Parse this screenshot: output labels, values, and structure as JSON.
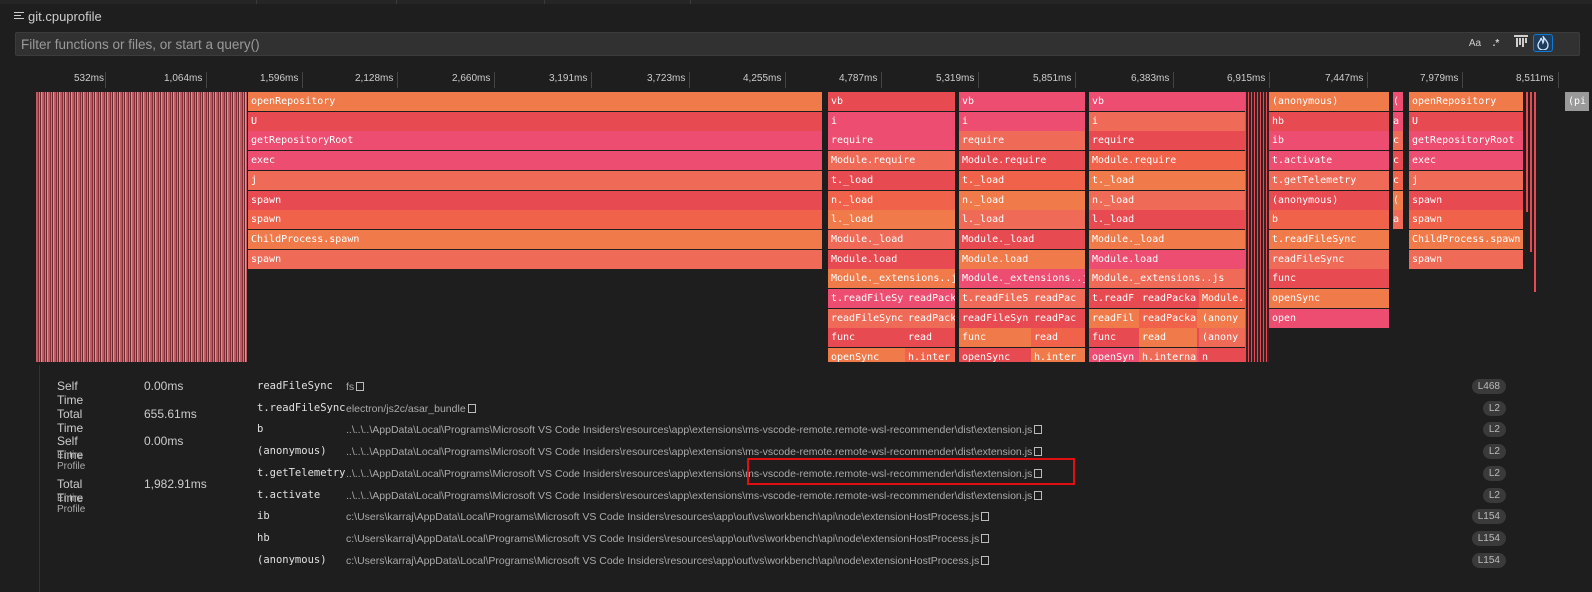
{
  "tab": {
    "title": "git.cpuprofile"
  },
  "filter": {
    "placeholder": "Filter functions or files, or start a query()",
    "case_label": "Aa",
    "regex_label": ".*",
    "buttons": [
      "match-case",
      "regex",
      "bottom-up",
      "flame"
    ]
  },
  "axis": {
    "ticks": [
      "532ms",
      "1,064ms",
      "1,596ms",
      "2,128ms",
      "2,660ms",
      "3,191ms",
      "3,723ms",
      "4,255ms",
      "4,787ms",
      "5,319ms",
      "5,851ms",
      "6,383ms",
      "6,915ms",
      "7,447ms",
      "7,979ms",
      "8,511ms"
    ]
  },
  "colors": {
    "orange": "#f07a4a",
    "red": "#e84a52",
    "pink": "#ec4d70",
    "salmon": "#ef6b58",
    "coral": "#f0624a",
    "grey": "#9a9a9a",
    "selected": "#0e70c0",
    "highlight": "#e01010"
  },
  "flame": {
    "col1": [
      "openRepository",
      "U",
      "getRepositoryRoot",
      "exec",
      "j",
      "spawn",
      "spawn",
      "ChildProcess.spawn",
      "spawn"
    ],
    "col2": [
      "vb",
      "i",
      "require",
      "Module.require",
      "t._load",
      "n._load",
      "l._load",
      "Module._load",
      "Module.load",
      "Module._extensions..js",
      "t.readFileSy",
      "readFileSync",
      "func",
      "openSync"
    ],
    "col2b": [
      "readPack",
      "readPack",
      "read",
      "h.inter"
    ],
    "col3": [
      "vb",
      "i",
      "require",
      "Module.require",
      "t._load",
      "n._load",
      "l._load",
      "Module._load",
      "Module.load",
      "Module._extensions..js",
      "t.readFileS",
      "readFileSyn",
      "func",
      "openSync"
    ],
    "col3b": [
      "readPac",
      "readPac",
      "read",
      "h.inter"
    ],
    "col4": [
      "vb",
      "i",
      "require",
      "Module.require",
      "t._load",
      "n._load",
      "l._load",
      "Module._load",
      "Module.load",
      "Module._extensions..js",
      "t.readF",
      "readFil",
      "func",
      "openSyn"
    ],
    "col4b": [
      "readPacka",
      "readPacka",
      "read",
      "h.interna"
    ],
    "col4c": [
      "Module.",
      "(anony",
      "(anony",
      "n"
    ],
    "col5": [
      "(anonymous)",
      "hb",
      "ib",
      "t.activate",
      "t.getTelemetry",
      "(anonymous)",
      "b",
      "t.readFileSync",
      "readFileSync",
      "func",
      "openSync",
      "open"
    ],
    "col6": [
      "openRepository",
      "U",
      "getRepositoryRoot",
      "exec",
      "j",
      "spawn",
      "spawn",
      "ChildProcess.spawn",
      "spawn"
    ],
    "col5_mini": [
      "(",
      "a",
      "c",
      "c",
      "c",
      "(",
      "a"
    ],
    "far_right": "(pi"
  },
  "stats": {
    "self_time_label": "Self Time",
    "self_time": "0.00ms",
    "total_time_label": "Total Time",
    "total_time": "655.61ms",
    "self_time_profile_label": "Self Time",
    "self_time_profile_sub": "Entire Profile",
    "self_time_profile": "0.00ms",
    "total_time_profile_label": "Total Time",
    "total_time_profile_sub": "Entire Profile",
    "total_time_profile": "1,982.91ms"
  },
  "stack": [
    {
      "fn": "readFileSync",
      "file": "fs",
      "line": "L468"
    },
    {
      "fn": "t.readFileSync",
      "file": "electron/js2c/asar_bundle",
      "line": "L2"
    },
    {
      "fn": "b",
      "file": "..\\..\\..\\AppData\\Local\\Programs\\Microsoft VS Code Insiders\\resources\\app\\extensions\\ms-vscode-remote.remote-wsl-recommender\\dist\\extension.js",
      "line": "L2"
    },
    {
      "fn": "(anonymous)",
      "file": "..\\..\\..\\AppData\\Local\\Programs\\Microsoft VS Code Insiders\\resources\\app\\extensions\\ms-vscode-remote.remote-wsl-recommender\\dist\\extension.js",
      "line": "L2"
    },
    {
      "fn": "t.getTelemetry",
      "file": "..\\..\\..\\AppData\\Local\\Programs\\Microsoft VS Code Insiders\\resources\\app\\extensions\\ms-vscode-remote.remote-wsl-recommender\\dist\\extension.js",
      "line": "L2"
    },
    {
      "fn": "t.activate",
      "file": "..\\..\\..\\AppData\\Local\\Programs\\Microsoft VS Code Insiders\\resources\\app\\extensions\\ms-vscode-remote.remote-wsl-recommender\\dist\\extension.js",
      "line": "L2"
    },
    {
      "fn": "ib",
      "file": "c:\\Users\\karraj\\AppData\\Local\\Programs\\Microsoft VS Code Insiders\\resources\\app\\out\\vs\\workbench\\api\\node\\extensionHostProcess.js",
      "line": "L154"
    },
    {
      "fn": "hb",
      "file": "c:\\Users\\karraj\\AppData\\Local\\Programs\\Microsoft VS Code Insiders\\resources\\app\\out\\vs\\workbench\\api\\node\\extensionHostProcess.js",
      "line": "L154"
    },
    {
      "fn": "(anonymous)",
      "file": "c:\\Users\\karraj\\AppData\\Local\\Programs\\Microsoft VS Code Insiders\\resources\\app\\out\\vs\\workbench\\api\\node\\extensionHostProcess.js",
      "line": "L154"
    }
  ]
}
